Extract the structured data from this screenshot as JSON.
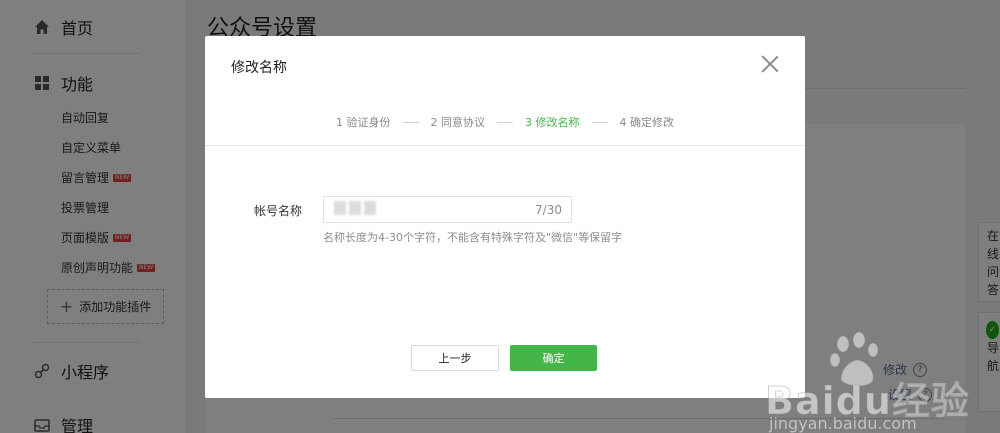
{
  "sidebar": {
    "home_label": "首页",
    "features_label": "功能",
    "sub_items": [
      {
        "label": "自动回复",
        "badge": ""
      },
      {
        "label": "自定义菜单",
        "badge": ""
      },
      {
        "label": "留言管理",
        "badge": "NEW"
      },
      {
        "label": "投票管理",
        "badge": ""
      },
      {
        "label": "页面模版",
        "badge": "NEW"
      },
      {
        "label": "原创声明功能",
        "badge": "NEW"
      }
    ],
    "add_plugin_label": "添加功能插件",
    "miniprogram_label": "小程序",
    "manage_label": "管理"
  },
  "page": {
    "title": "公众号设置",
    "modify_link": "修改",
    "settings_link": "设置",
    "help_glyph": "?"
  },
  "right_widget": {
    "lines": [
      "在",
      "线",
      "问",
      "答"
    ],
    "lines2": [
      "导",
      "航"
    ]
  },
  "modal": {
    "title": "修改名称",
    "steps": [
      {
        "label": "1 验证身份",
        "active": false
      },
      {
        "label": "2 同意协议",
        "active": false
      },
      {
        "label": "3 修改名称",
        "active": true
      },
      {
        "label": "4 确定修改",
        "active": false
      }
    ],
    "field_label": "帐号名称",
    "counter": "7/30",
    "hint": "名称长度为4-30个字符，不能含有特殊字符及\"微信\"等保留字",
    "prev_button": "上一步",
    "confirm_button": "确定"
  },
  "watermark": {
    "brand": "Baidu经验",
    "url": "jingyan.baidu.com"
  },
  "colors": {
    "accent_green": "#44b549",
    "overlay": "rgba(0,0,0,0.5)",
    "badge_red": "#e64340"
  }
}
